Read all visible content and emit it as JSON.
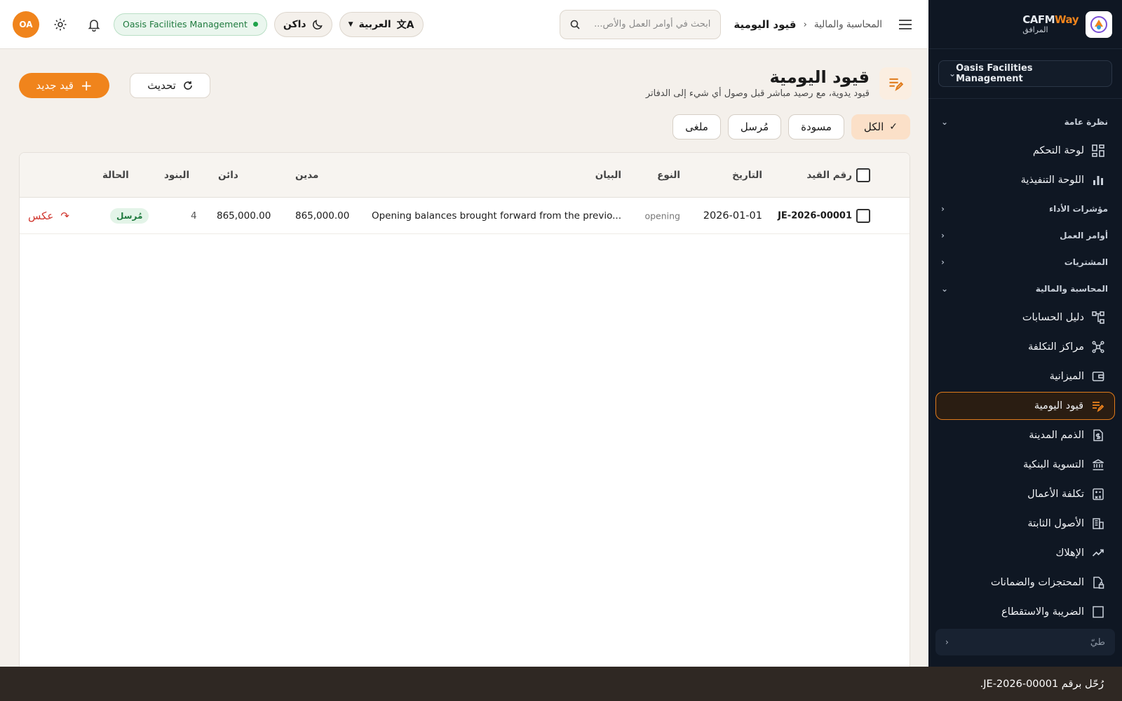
{
  "sidebar": {
    "brand_name_a": "CAFM",
    "brand_name_b": "Way",
    "brand_sub": "المرافق",
    "org": "Oasis Facilities Management",
    "overview": "نظرة عامة",
    "dashboard": "لوحة التحكم",
    "executive": "اللوحة التنفيذية",
    "kpis": "مؤشرات الأداء",
    "work_orders": "أوامر العمل",
    "procurement": "المشتريات",
    "finance": "المحاسبة والمالية",
    "chart_accounts": "دليل الحسابات",
    "cost_centers": "مراكز التكلفة",
    "budget": "الميزانية",
    "journal": "قيود اليومية",
    "receivables": "الذمم المدينة",
    "bank_rec": "التسوية البنكية",
    "job_cost": "تكلفة الأعمال",
    "fixed_assets": "الأصول الثابتة",
    "depreciation": "الإهلاك",
    "retentions": "المحتجزات والضمانات",
    "tax": "الضريبة والاستقطاع",
    "collapse": "طيّ"
  },
  "topbar": {
    "avatar": "OA",
    "org_pill": "Oasis Facilities Management",
    "theme": "داكن",
    "language": "العربية",
    "search_placeholder": "ابحث في أوامر العمل والأص...",
    "crumb_parent": "المحاسبة والمالية",
    "crumb_current": "قيود اليومية"
  },
  "page": {
    "title": "قيود اليومية",
    "subtitle": "قيود يدوية، مع رصيد مباشر قبل وصول أي شيء إلى الدفاتر",
    "new_button": "قيد جديد",
    "refresh_button": "تحديث"
  },
  "filters": [
    "الكل",
    "مسودة",
    "مُرسل",
    "ملغى"
  ],
  "table": {
    "headers": {
      "entry_no": "رقم القيد",
      "date": "التاريخ",
      "type": "النوع",
      "description": "البيان",
      "debit": "مدين",
      "credit": "دائن",
      "lines": "البنود",
      "status": "الحالة"
    },
    "rows": [
      {
        "entry_no": "JE-2026-00001",
        "date": "2026-01-01",
        "type": "opening",
        "description": "Opening balances brought forward from the previo...",
        "debit": "865,000.00",
        "credit": "865,000.00",
        "lines": "4",
        "status": "مُرسل",
        "action": "عكس"
      }
    ]
  },
  "toast": "رُحّل برقم JE-2026-00001."
}
